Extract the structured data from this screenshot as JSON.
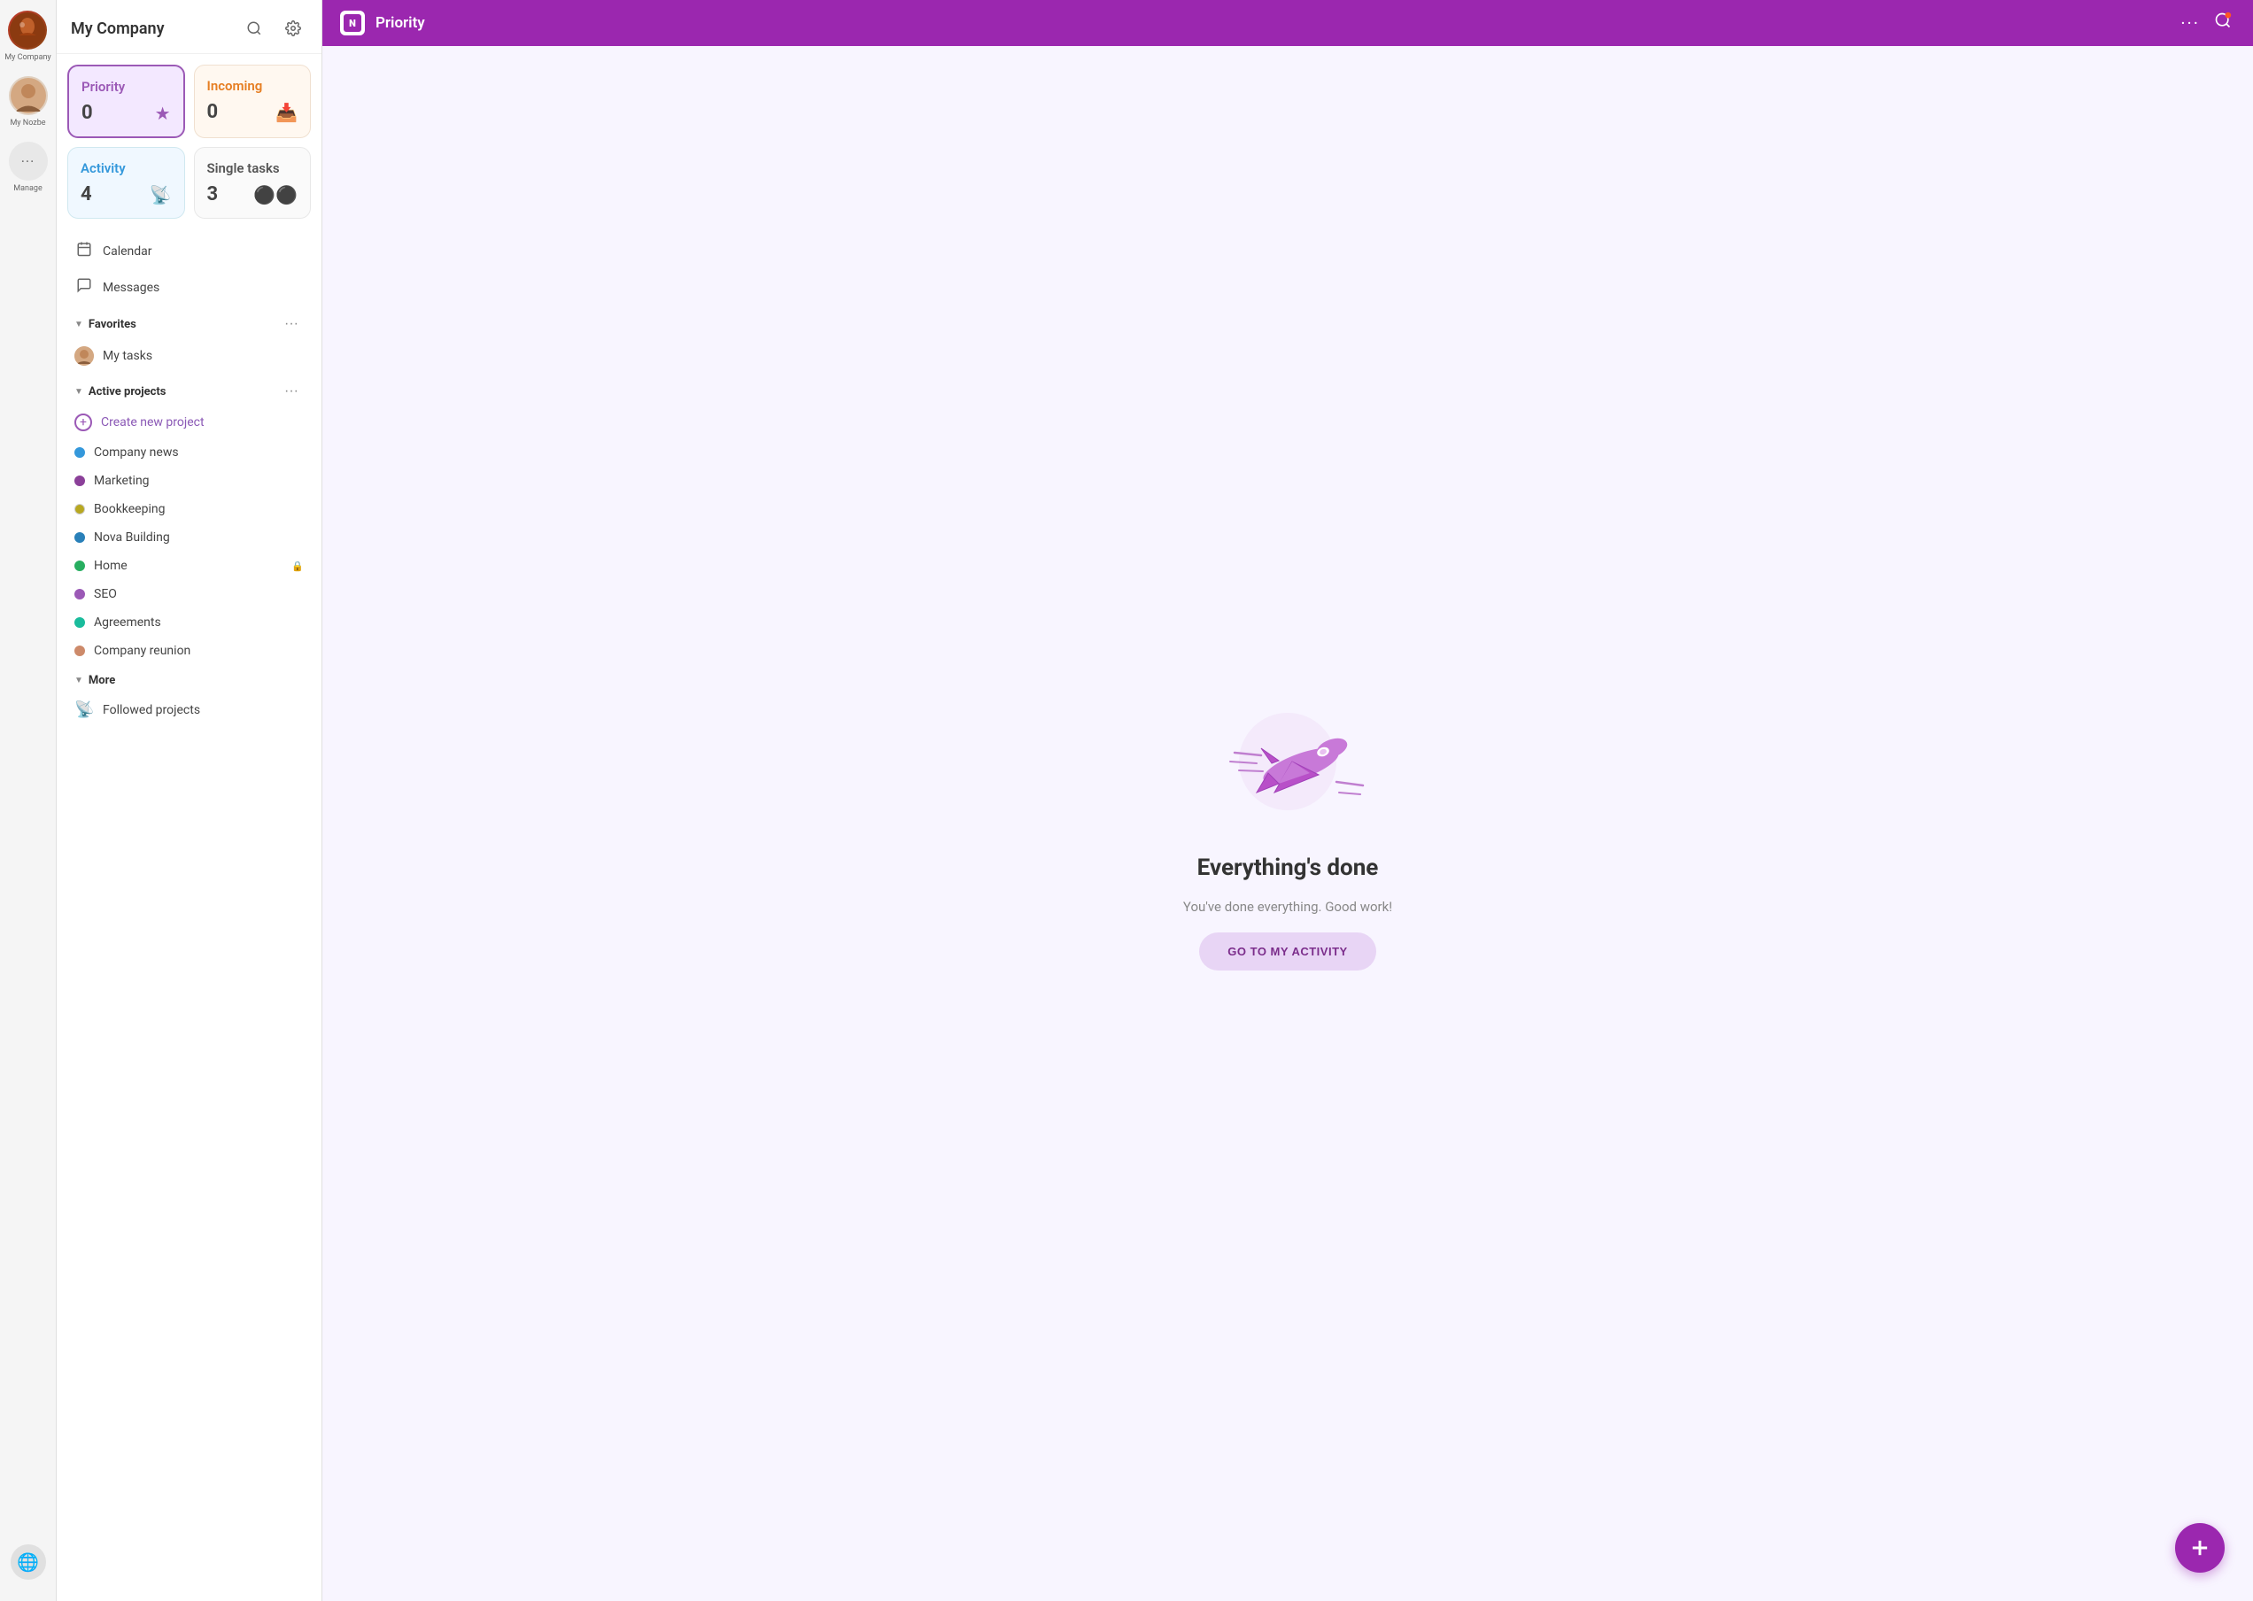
{
  "iconBar": {
    "companyLabel": "My Company",
    "nozbeLabel": "My Nozbe",
    "manageLabel": "Manage"
  },
  "sidebar": {
    "title": "My Company",
    "cards": [
      {
        "id": "priority",
        "title": "Priority",
        "count": "0",
        "type": "priority"
      },
      {
        "id": "incoming",
        "title": "Incoming",
        "count": "0",
        "type": "incoming"
      },
      {
        "id": "activity",
        "title": "Activity",
        "count": "4",
        "type": "activity"
      },
      {
        "id": "single-tasks",
        "title": "Single tasks",
        "count": "3",
        "type": "single"
      }
    ],
    "navItems": [
      {
        "id": "calendar",
        "label": "Calendar",
        "icon": "📅"
      },
      {
        "id": "messages",
        "label": "Messages",
        "icon": "💬"
      }
    ],
    "favorites": {
      "title": "Favorites",
      "items": [
        {
          "id": "my-tasks",
          "label": "My tasks"
        }
      ]
    },
    "activeProjects": {
      "title": "Active projects",
      "createLabel": "Create new project",
      "projects": [
        {
          "id": "company-news",
          "name": "Company news",
          "color": "#3498db"
        },
        {
          "id": "marketing",
          "name": "Marketing",
          "color": "#8b4099"
        },
        {
          "id": "bookkeeping",
          "name": "Bookkeeping",
          "color": "#b8a820"
        },
        {
          "id": "nova-building",
          "name": "Nova Building",
          "color": "#2980b9"
        },
        {
          "id": "home",
          "name": "Home",
          "color": "#27ae60",
          "locked": true
        },
        {
          "id": "seo",
          "name": "SEO",
          "color": "#9b59b6"
        },
        {
          "id": "agreements",
          "name": "Agreements",
          "color": "#1abc9c"
        },
        {
          "id": "company-reunion",
          "name": "Company reunion",
          "color": "#cd8a6a"
        }
      ]
    },
    "more": {
      "title": "More",
      "items": [
        {
          "id": "followed-projects",
          "label": "Followed projects"
        }
      ]
    }
  },
  "topBar": {
    "title": "Priority",
    "logoAlt": "Nozbe logo"
  },
  "mainContent": {
    "emptyState": {
      "title": "Everything's done",
      "subtitle": "You've done everything. Good work!",
      "buttonLabel": "GO TO MY ACTIVITY"
    }
  }
}
